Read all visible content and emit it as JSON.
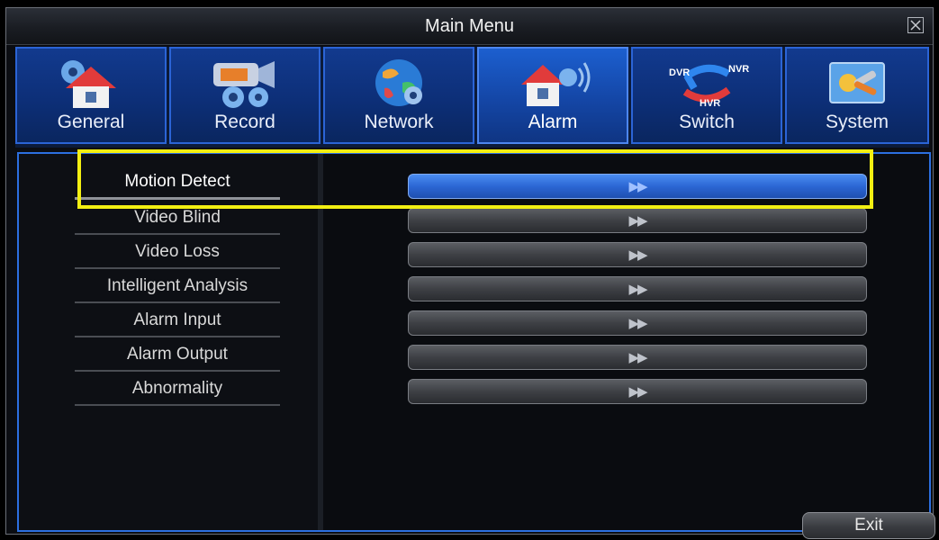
{
  "window": {
    "title": "Main Menu"
  },
  "tabs": [
    {
      "label": "General",
      "icon": "house-gear-icon"
    },
    {
      "label": "Record",
      "icon": "camera-gear-icon"
    },
    {
      "label": "Network",
      "icon": "globe-gear-icon"
    },
    {
      "label": "Alarm",
      "icon": "house-alarm-icon"
    },
    {
      "label": "Switch",
      "icon": "dvr-nvr-hvr-switch-icon",
      "icon_text": {
        "dvr": "DVR",
        "nvr": "NVR",
        "hvr": "HVR"
      }
    },
    {
      "label": "System",
      "icon": "tools-icon"
    }
  ],
  "active_tab": "Alarm",
  "menu": [
    {
      "label": "Motion Detect",
      "action": "▶▶"
    },
    {
      "label": "Video Blind",
      "action": "▶▶"
    },
    {
      "label": "Video Loss",
      "action": "▶▶"
    },
    {
      "label": "Intelligent Analysis",
      "action": "▶▶"
    },
    {
      "label": "Alarm Input",
      "action": "▶▶"
    },
    {
      "label": "Alarm Output",
      "action": "▶▶"
    },
    {
      "label": "Abnormality",
      "action": "▶▶"
    }
  ],
  "active_menu": "Motion Detect",
  "exit_label": "Exit",
  "colors": {
    "accent_blue": "#2c6fe0",
    "highlight_yellow": "#f2ef12"
  }
}
